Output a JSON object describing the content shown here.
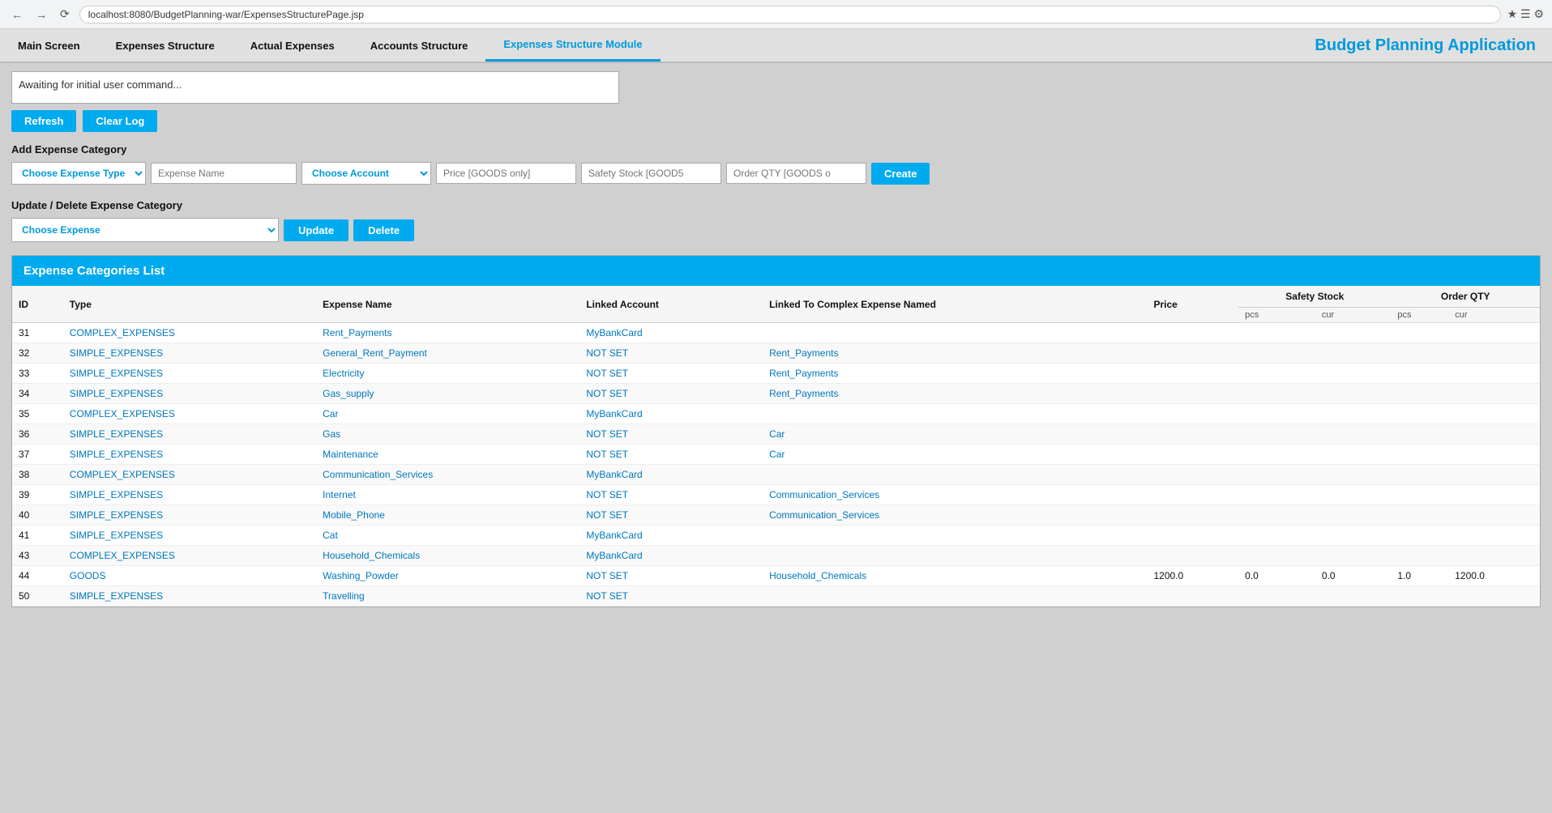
{
  "browser": {
    "url": "localhost:8080/BudgetPlanning-war/ExpensesStructurePage.jsp",
    "back_label": "←",
    "forward_label": "→",
    "refresh_label": "↻"
  },
  "nav": {
    "items": [
      {
        "label": "Main Screen",
        "active": false
      },
      {
        "label": "Expenses Structure",
        "active": false
      },
      {
        "label": "Actual Expenses",
        "active": false
      },
      {
        "label": "Accounts Structure",
        "active": false
      },
      {
        "label": "Expenses Structure Module",
        "active": true
      }
    ],
    "app_title": "Budget Planning Application"
  },
  "log": {
    "message": "Awaiting for initial user command...",
    "refresh_label": "Refresh",
    "clear_label": "Clear Log"
  },
  "add_section": {
    "label": "Add Expense Category",
    "type_placeholder": "Choose Expense Type",
    "name_placeholder": "Expense Name",
    "account_placeholder": "Choose Account",
    "price_placeholder": "Price [GOODS only]",
    "safety_placeholder": "Safety Stock [GOOD5",
    "orderqty_placeholder": "Order QTY [GOODS o",
    "create_label": "Create"
  },
  "update_section": {
    "label": "Update / Delete Expense Category",
    "expense_placeholder": "Choose Expense",
    "update_label": "Update",
    "delete_label": "Delete"
  },
  "table": {
    "header": "Expense Categories List",
    "columns": {
      "id": "ID",
      "type": "Type",
      "expense_name": "Expense Name",
      "linked_account": "Linked Account",
      "linked_to_complex": "Linked To Complex Expense Named",
      "price": "Price",
      "safety_stock_pcs": "pcs",
      "safety_stock_cur": "cur",
      "order_qty_pcs": "pcs",
      "order_qty_cur": "cur",
      "safety_stock_label": "Safety Stock",
      "order_qty_label": "Order QTY"
    },
    "rows": [
      {
        "id": "31",
        "type": "COMPLEX_EXPENSES",
        "expense_name": "Rent_Payments",
        "linked_account": "MyBankCard",
        "linked_complex": "",
        "price": "",
        "ss_pcs": "",
        "ss_cur": "",
        "oq_pcs": "",
        "oq_cur": ""
      },
      {
        "id": "32",
        "type": "SIMPLE_EXPENSES",
        "expense_name": "General_Rent_Payment",
        "linked_account": "NOT SET",
        "linked_complex": "Rent_Payments",
        "price": "",
        "ss_pcs": "",
        "ss_cur": "",
        "oq_pcs": "",
        "oq_cur": ""
      },
      {
        "id": "33",
        "type": "SIMPLE_EXPENSES",
        "expense_name": "Electricity",
        "linked_account": "NOT SET",
        "linked_complex": "Rent_Payments",
        "price": "",
        "ss_pcs": "",
        "ss_cur": "",
        "oq_pcs": "",
        "oq_cur": ""
      },
      {
        "id": "34",
        "type": "SIMPLE_EXPENSES",
        "expense_name": "Gas_supply",
        "linked_account": "NOT SET",
        "linked_complex": "Rent_Payments",
        "price": "",
        "ss_pcs": "",
        "ss_cur": "",
        "oq_pcs": "",
        "oq_cur": ""
      },
      {
        "id": "35",
        "type": "COMPLEX_EXPENSES",
        "expense_name": "Car",
        "linked_account": "MyBankCard",
        "linked_complex": "",
        "price": "",
        "ss_pcs": "",
        "ss_cur": "",
        "oq_pcs": "",
        "oq_cur": ""
      },
      {
        "id": "36",
        "type": "SIMPLE_EXPENSES",
        "expense_name": "Gas",
        "linked_account": "NOT SET",
        "linked_complex": "Car",
        "price": "",
        "ss_pcs": "",
        "ss_cur": "",
        "oq_pcs": "",
        "oq_cur": ""
      },
      {
        "id": "37",
        "type": "SIMPLE_EXPENSES",
        "expense_name": "Maintenance",
        "linked_account": "NOT SET",
        "linked_complex": "Car",
        "price": "",
        "ss_pcs": "",
        "ss_cur": "",
        "oq_pcs": "",
        "oq_cur": ""
      },
      {
        "id": "38",
        "type": "COMPLEX_EXPENSES",
        "expense_name": "Communication_Services",
        "linked_account": "MyBankCard",
        "linked_complex": "",
        "price": "",
        "ss_pcs": "",
        "ss_cur": "",
        "oq_pcs": "",
        "oq_cur": ""
      },
      {
        "id": "39",
        "type": "SIMPLE_EXPENSES",
        "expense_name": "Internet",
        "linked_account": "NOT SET",
        "linked_complex": "Communication_Services",
        "price": "",
        "ss_pcs": "",
        "ss_cur": "",
        "oq_pcs": "",
        "oq_cur": ""
      },
      {
        "id": "40",
        "type": "SIMPLE_EXPENSES",
        "expense_name": "Mobile_Phone",
        "linked_account": "NOT SET",
        "linked_complex": "Communication_Services",
        "price": "",
        "ss_pcs": "",
        "ss_cur": "",
        "oq_pcs": "",
        "oq_cur": ""
      },
      {
        "id": "41",
        "type": "SIMPLE_EXPENSES",
        "expense_name": "Cat",
        "linked_account": "MyBankCard",
        "linked_complex": "",
        "price": "",
        "ss_pcs": "",
        "ss_cur": "",
        "oq_pcs": "",
        "oq_cur": ""
      },
      {
        "id": "43",
        "type": "COMPLEX_EXPENSES",
        "expense_name": "Household_Chemicals",
        "linked_account": "MyBankCard",
        "linked_complex": "",
        "price": "",
        "ss_pcs": "",
        "ss_cur": "",
        "oq_pcs": "",
        "oq_cur": ""
      },
      {
        "id": "44",
        "type": "GOODS",
        "expense_name": "Washing_Powder",
        "linked_account": "NOT SET",
        "linked_complex": "Household_Chemicals",
        "price": "1200.0",
        "ss_pcs": "0.0",
        "ss_cur": "0.0",
        "oq_pcs": "1.0",
        "oq_cur": "1200.0"
      },
      {
        "id": "50",
        "type": "SIMPLE_EXPENSES",
        "expense_name": "Travelling",
        "linked_account": "NOT SET",
        "linked_complex": "",
        "price": "",
        "ss_pcs": "",
        "ss_cur": "",
        "oq_pcs": "",
        "oq_cur": ""
      }
    ]
  }
}
